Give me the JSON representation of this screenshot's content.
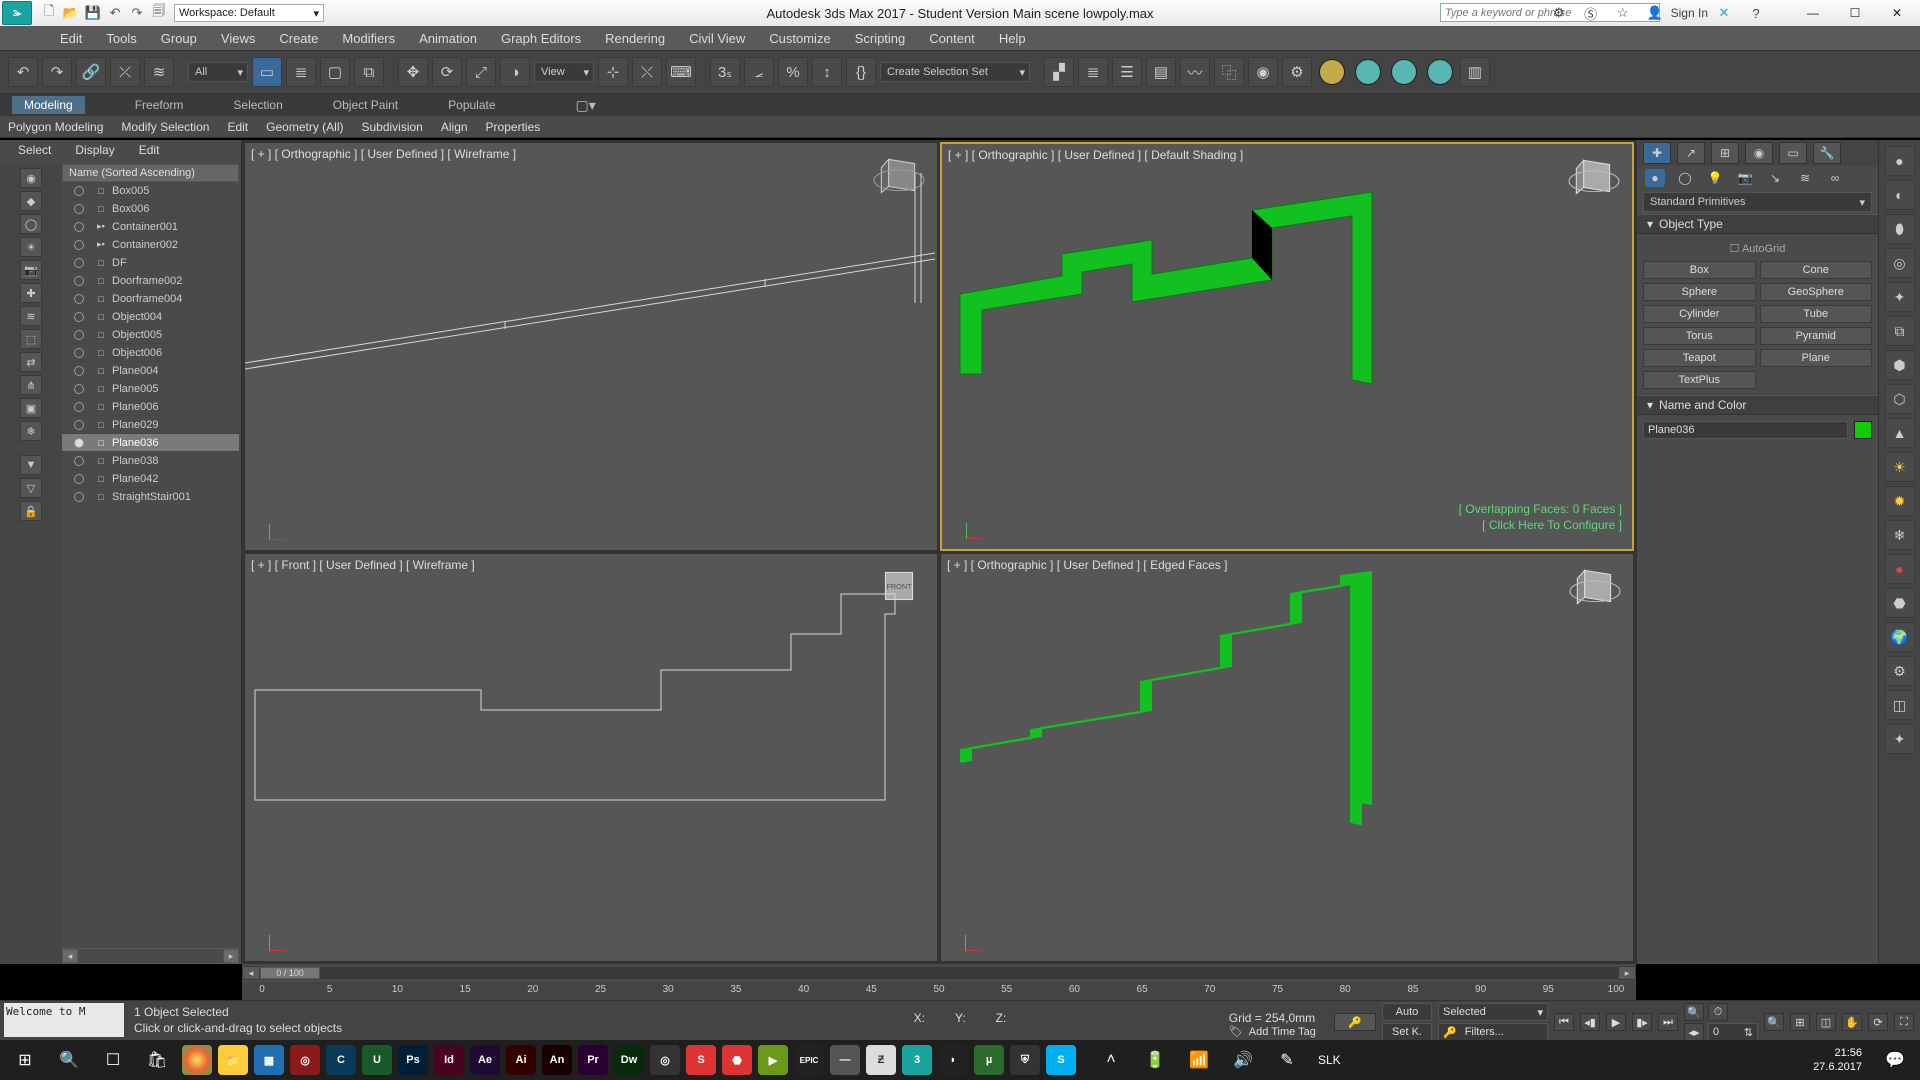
{
  "titlebar": {
    "workspace_label": "Workspace: Default",
    "app_title": "Autodesk 3ds Max 2017 - Student Version    Main scene lowpoly.max",
    "search_placeholder": "Type a keyword or phrase",
    "sign_in": "Sign In"
  },
  "mainmenu": [
    "Edit",
    "Tools",
    "Group",
    "Views",
    "Create",
    "Modifiers",
    "Animation",
    "Graph Editors",
    "Rendering",
    "Civil View",
    "Customize",
    "Scripting",
    "Content",
    "Help"
  ],
  "toolbar": {
    "filter_combo": "All",
    "view_combo": "View",
    "selection_set_combo": "Create Selection Set"
  },
  "ribbon": {
    "tabs": [
      "Modeling",
      "Freeform",
      "Selection",
      "Object Paint",
      "Populate"
    ],
    "active": "Modeling",
    "sub": [
      "Polygon Modeling",
      "Modify Selection",
      "Edit",
      "Geometry (All)",
      "Subdivision",
      "Align",
      "Properties"
    ]
  },
  "explorer": {
    "menus": [
      "Select",
      "Display",
      "Edit"
    ],
    "header": "Name (Sorted Ascending)",
    "rows": [
      {
        "name": "Box005",
        "icon": "□",
        "sel": false,
        "vis": false
      },
      {
        "name": "Box006",
        "icon": "□",
        "sel": false,
        "vis": false
      },
      {
        "name": "Container001",
        "icon": "▸▪",
        "sel": false,
        "vis": false
      },
      {
        "name": "Container002",
        "icon": "▸▪",
        "sel": false,
        "vis": false
      },
      {
        "name": "DF",
        "icon": "□",
        "sel": false,
        "vis": false
      },
      {
        "name": "Doorframe002",
        "icon": "□",
        "sel": false,
        "vis": false
      },
      {
        "name": "Doorframe004",
        "icon": "□",
        "sel": false,
        "vis": false
      },
      {
        "name": "Object004",
        "icon": "□",
        "sel": false,
        "vis": false
      },
      {
        "name": "Object005",
        "icon": "□",
        "sel": false,
        "vis": false
      },
      {
        "name": "Object006",
        "icon": "□",
        "sel": false,
        "vis": false
      },
      {
        "name": "Plane004",
        "icon": "□",
        "sel": false,
        "vis": false
      },
      {
        "name": "Plane005",
        "icon": "□",
        "sel": false,
        "vis": false
      },
      {
        "name": "Plane006",
        "icon": "□",
        "sel": false,
        "vis": false
      },
      {
        "name": "Plane029",
        "icon": "□",
        "sel": false,
        "vis": false
      },
      {
        "name": "Plane036",
        "icon": "□",
        "sel": true,
        "vis": true
      },
      {
        "name": "Plane038",
        "icon": "□",
        "sel": false,
        "vis": false
      },
      {
        "name": "Plane042",
        "icon": "□",
        "sel": false,
        "vis": false
      },
      {
        "name": "StraightStair001",
        "icon": "□",
        "sel": false,
        "vis": false
      }
    ]
  },
  "viewports": {
    "tl": "[ + ] [ Orthographic ]  [ User Defined ]  [ Wireframe ]",
    "tr": "[ + ] [ Orthographic ]  [ User Defined ]  [ Default Shading ]",
    "bl": "[ + ] [ Front ]  [ User Defined ]  [ Wireframe ]",
    "br": "[ + ] [ Orthographic ]  [ User Defined ]  [ Edged Faces ]",
    "overlay1": "[ Overlapping Faces: 0 Faces ]",
    "overlay2": "[ Click Here To Configure ]"
  },
  "cmdpanel": {
    "category": "Standard Primitives",
    "rollout_objtype": "Object Type",
    "autogrid": "AutoGrid",
    "primitives": [
      "Box",
      "Cone",
      "Sphere",
      "GeoSphere",
      "Cylinder",
      "Tube",
      "Torus",
      "Pyramid",
      "Teapot",
      "Plane",
      "TextPlus"
    ],
    "rollout_name": "Name and Color",
    "object_name": "Plane036",
    "object_color": "#1ac800"
  },
  "timeline": {
    "frame_display": "0 / 100",
    "ticks": [
      0,
      5,
      10,
      15,
      20,
      25,
      30,
      35,
      40,
      45,
      50,
      55,
      60,
      65,
      70,
      75,
      80,
      85,
      90,
      95,
      100
    ]
  },
  "status": {
    "script": "Welcome to M",
    "selection": "1 Object Selected",
    "hint": "Click or click-and-drag to select objects",
    "x": "X:",
    "y": "Y:",
    "z": "Z:",
    "grid": "Grid = 254,0mm",
    "timetag": "Add Time Tag",
    "auto": "Auto",
    "setk": "Set K.",
    "selected": "Selected",
    "filters": "Filters...",
    "curframe": "0"
  },
  "taskbar": {
    "lang": "SLK",
    "time": "21:56",
    "date": "27.6.2017"
  }
}
